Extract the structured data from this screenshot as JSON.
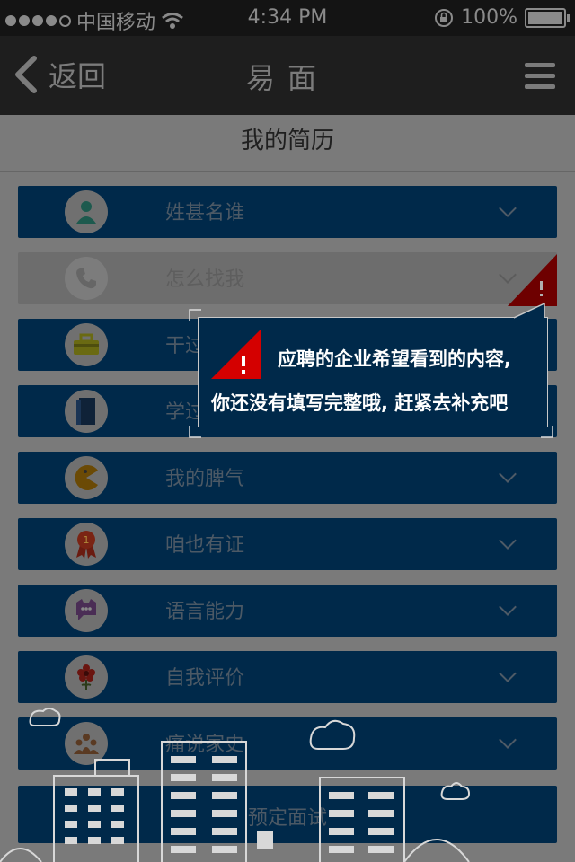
{
  "status_bar": {
    "carrier": "中国移动",
    "time": "4:34 PM",
    "battery": "100%"
  },
  "nav": {
    "back_label": "返回",
    "title": "易面"
  },
  "header": {
    "title": "我的简历"
  },
  "sections": [
    {
      "label": "姓甚名谁",
      "icon": "person-icon"
    },
    {
      "label": "怎么找我",
      "icon": "phone-icon"
    },
    {
      "label": "干过什么",
      "icon": "briefcase-icon"
    },
    {
      "label": "学过什么",
      "icon": "book-icon"
    },
    {
      "label": "我的脾气",
      "icon": "pacman-icon"
    },
    {
      "label": "咱也有证",
      "icon": "medal-icon"
    },
    {
      "label": "语言能力",
      "icon": "chat-bubble-icon"
    },
    {
      "label": "自我评价",
      "icon": "flower-icon"
    },
    {
      "label": "痛说家史",
      "icon": "family-icon"
    }
  ],
  "bottom_button": {
    "label": "预定面试"
  },
  "tooltip": {
    "line1": "应聘的企业希望看到的内容,",
    "line2": "你还没有填写完整哦, 赶紧去补充吧"
  },
  "colors": {
    "row_bg": "#00294a",
    "warning": "#d40000",
    "overlay": "#7a7a7a"
  }
}
